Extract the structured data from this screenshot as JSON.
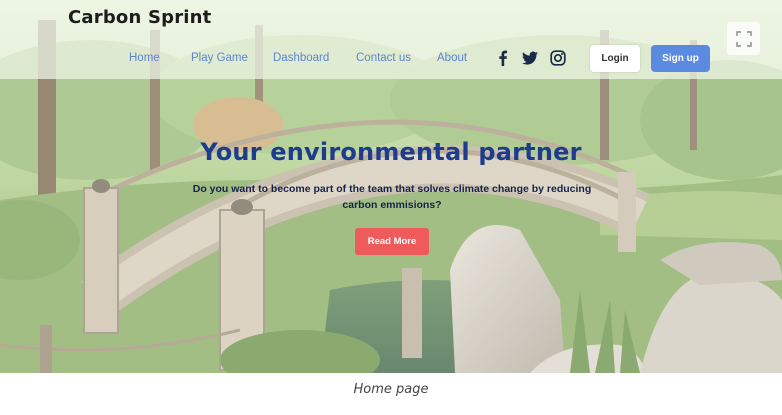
{
  "brand": {
    "name": "Carbon Sprint"
  },
  "nav": {
    "items": [
      {
        "label": "Home"
      },
      {
        "label": "Play Game"
      },
      {
        "label": "Dashboard"
      },
      {
        "label": "Contact us"
      },
      {
        "label": "About"
      }
    ]
  },
  "social": {
    "icons": [
      "facebook-icon",
      "twitter-icon",
      "instagram-icon"
    ]
  },
  "auth": {
    "login_label": "Login",
    "signup_label": "Sign up"
  },
  "viewer": {
    "fullscreen_icon": "fullscreen-icon"
  },
  "hero": {
    "title": "Your environmental partner",
    "subtitle_line1": "Do you want to become part of the team that solves climate change by reducing",
    "subtitle_line2": "carbon emmisions?",
    "cta_label": "Read More"
  },
  "caption": {
    "text": "Home page"
  },
  "colors": {
    "nav_link": "#5d84d0",
    "title": "#1d3d8c",
    "signup_bg": "#5b8be0",
    "cta_bg": "#ef5b5b"
  }
}
